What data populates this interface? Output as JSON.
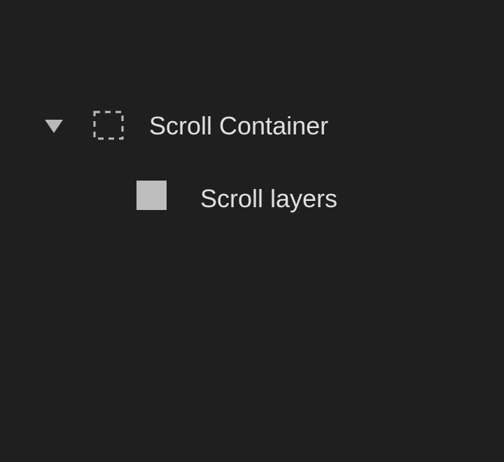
{
  "layers_panel": {
    "items": [
      {
        "label": "Scroll Container",
        "icon": "frame-dashed-icon",
        "expanded": true,
        "indent_level": 0
      },
      {
        "label": "Scroll layers",
        "icon": "fill-rect-icon",
        "indent_level": 1
      }
    ]
  },
  "colors": {
    "background": "#1f1f1f",
    "text": "#e0e0e0",
    "icon": "#bdbdbd"
  }
}
